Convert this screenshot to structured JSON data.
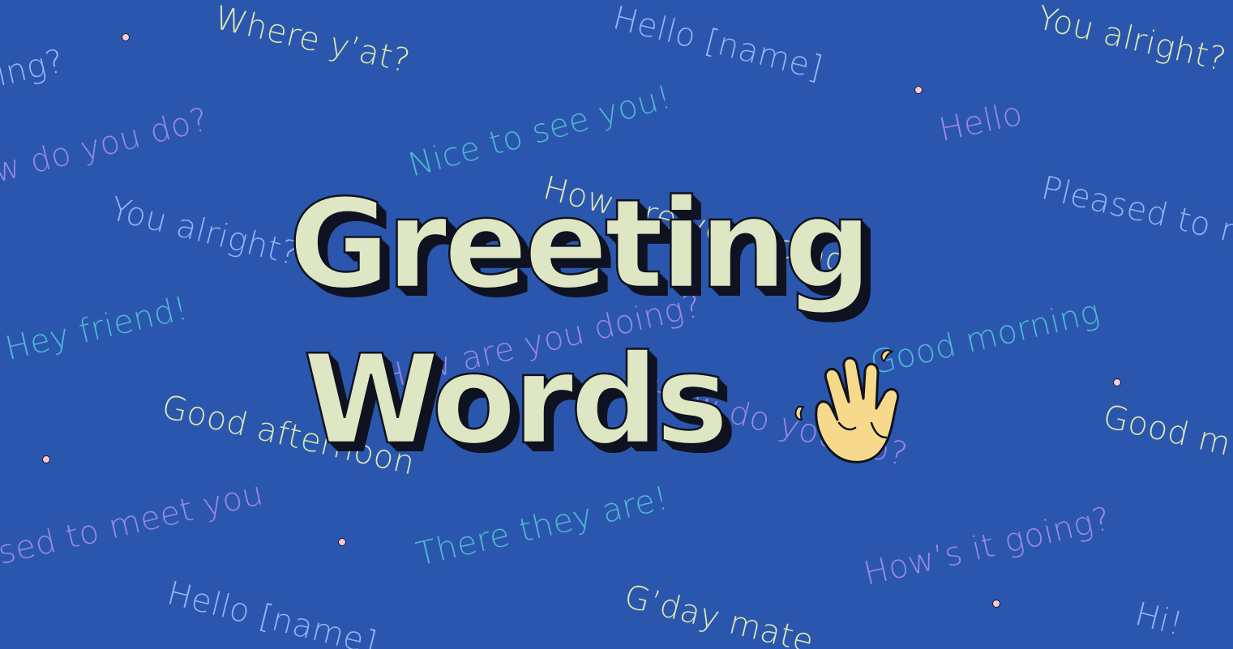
{
  "title": {
    "line1": "Greeting",
    "line2": "Words"
  },
  "icons": {
    "wave": "waving-hand-icon"
  },
  "colors": {
    "background": "#2a57ad",
    "title_fill": "#dfe6c3",
    "title_outline": "#0f1220",
    "yellow": "#dce6b2",
    "purple": "#9a88e0",
    "teal": "#4fb6cf",
    "blue": "#8cb6f2",
    "dot": "#f4c9d8"
  },
  "phrases": {
    "p1": "Where y’at?",
    "p2": "Hello [name]",
    "p3": "You alright?",
    "p4": "ing?",
    "p5": "w do you do?",
    "p6": "Nice to see you!",
    "p7": "Hello",
    "p8": "You alright?",
    "p9": "How are you doing?",
    "p10": "Pleased to m",
    "p11": "Hey friend!",
    "p12": "How are you doing?",
    "p13": "Good morning",
    "p14": "Good afternoon",
    "p15": "How do you do?",
    "p16": "Good m",
    "p17": "sed to meet you",
    "p18": "There they are!",
    "p19": "How’s it going?",
    "p20": "Hello [name]",
    "p21": "G’day mate",
    "p22": "Hi!"
  }
}
